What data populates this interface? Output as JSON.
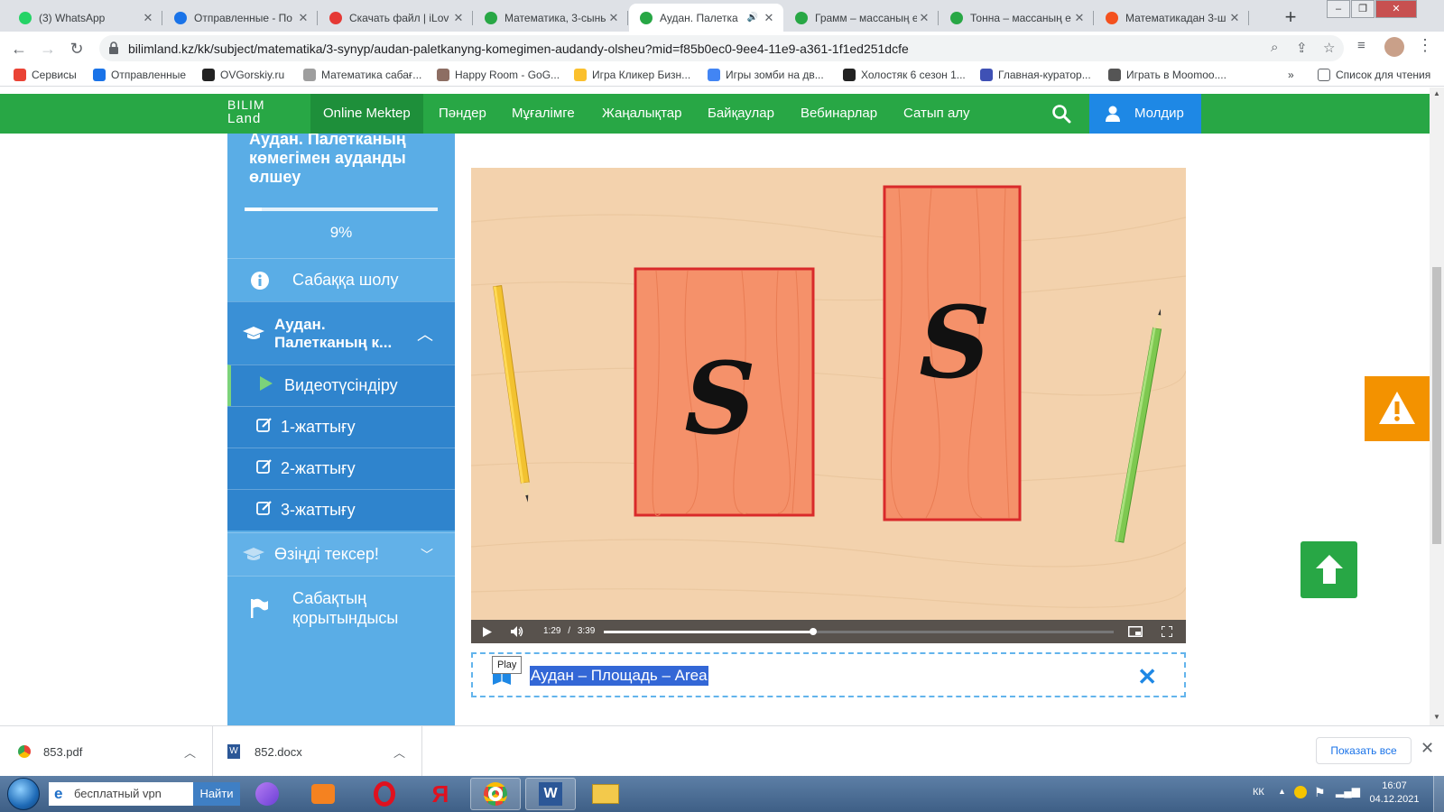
{
  "browser": {
    "tabs": [
      {
        "title": "(3) WhatsApp",
        "favicon_color": "#25d366",
        "active": false
      },
      {
        "title": "Отправленные - По",
        "favicon_color": "#1a73e8",
        "active": false
      },
      {
        "title": "Скачать файл | iLov",
        "favicon_color": "#e53935",
        "active": false
      },
      {
        "title": "Математика, 3-сынь",
        "favicon_color": "#28a745",
        "active": false
      },
      {
        "title": "Аудан. Палетка",
        "favicon_color": "#28a745",
        "active": true
      },
      {
        "title": "Грамм – массаның е",
        "favicon_color": "#28a745",
        "active": false
      },
      {
        "title": "Тонна – массаның е",
        "favicon_color": "#28a745",
        "active": false
      },
      {
        "title": "Математикадан 3-ш",
        "favicon_color": "#f4511e",
        "active": false
      }
    ],
    "url": "bilimland.kz/kk/subject/matematika/3-synyp/audan-paletkanyng-komegimen-audandy-olsheu?mid=f85b0ec0-9ee4-11e9-a361-1f1ed251dcfe",
    "bookmarks": [
      {
        "label": "Сервисы",
        "color": "#ea4335"
      },
      {
        "label": "Отправленные",
        "color": "#1a73e8"
      },
      {
        "label": "OVGorskiy.ru",
        "color": "#222222"
      },
      {
        "label": "Математика сабағ...",
        "color": "#9e9e9e"
      },
      {
        "label": "Happy Room - GoG...",
        "color": "#8d6e63"
      },
      {
        "label": "Игра Кликер Бизн...",
        "color": "#fbc02d"
      },
      {
        "label": "Игры зомби на дв...",
        "color": "#4285f4"
      },
      {
        "label": "Холостяк 6 сезон 1...",
        "color": "#222222"
      },
      {
        "label": "Главная-куратор...",
        "color": "#3f51b5"
      },
      {
        "label": "Играть в Moomoo....",
        "color": "#555555"
      }
    ],
    "reading_list": "Список для чтения",
    "more_bookmarks": "»"
  },
  "site": {
    "logo_line1": "BILIM",
    "logo_line2": "Land",
    "menu": [
      {
        "label": "Online Mektep",
        "active": true
      },
      {
        "label": "Пәндер",
        "active": false
      },
      {
        "label": "Мұғалімге",
        "active": false
      },
      {
        "label": "Жаңалықтар",
        "active": false
      },
      {
        "label": "Байқаулар",
        "active": false
      },
      {
        "label": "Вебинарлар",
        "active": false
      },
      {
        "label": "Сатып алу",
        "active": false
      }
    ],
    "user_name": "Молдир"
  },
  "sidebar": {
    "lesson_title": "Аудан. Палетканың көмегімен ауданды өлшеу",
    "progress_percent": 9,
    "progress_label": "9%",
    "overview": "Сабаққа шолу",
    "section_title": "Аудан. Палетканың к...",
    "section_title_line1": "Аудан.",
    "section_title_line2": "Палетканың к...",
    "items": [
      {
        "label": "Видеотүсіндіру",
        "icon": "play-icon"
      },
      {
        "label": "1-жаттығу",
        "icon": "edit-icon"
      },
      {
        "label": "2-жаттығу",
        "icon": "edit-icon"
      },
      {
        "label": "3-жаттығу",
        "icon": "edit-icon"
      }
    ],
    "self_check": "Өзіңді тексер!",
    "summary": "Сабақтың қорытындысы",
    "summary_line1": "Сабақтың",
    "summary_line2": "қорытындысы"
  },
  "video": {
    "letter": "S",
    "current_time": "1:29",
    "separator": "/",
    "duration": "3:39",
    "progress_fraction": 0.41
  },
  "glossary": {
    "term": "Аудан – Площадь – Area",
    "tooltip": "Play"
  },
  "downloads": [
    {
      "name": "853.pdf",
      "icon": "pdf-icon"
    },
    {
      "name": "852.docx",
      "icon": "word-icon"
    }
  ],
  "downloads_show_all": "Показать все",
  "taskbar": {
    "search_value": "бесплатный vpn",
    "search_button": "Найти",
    "language": "КК",
    "time": "16:07",
    "date": "04.12.2021"
  }
}
